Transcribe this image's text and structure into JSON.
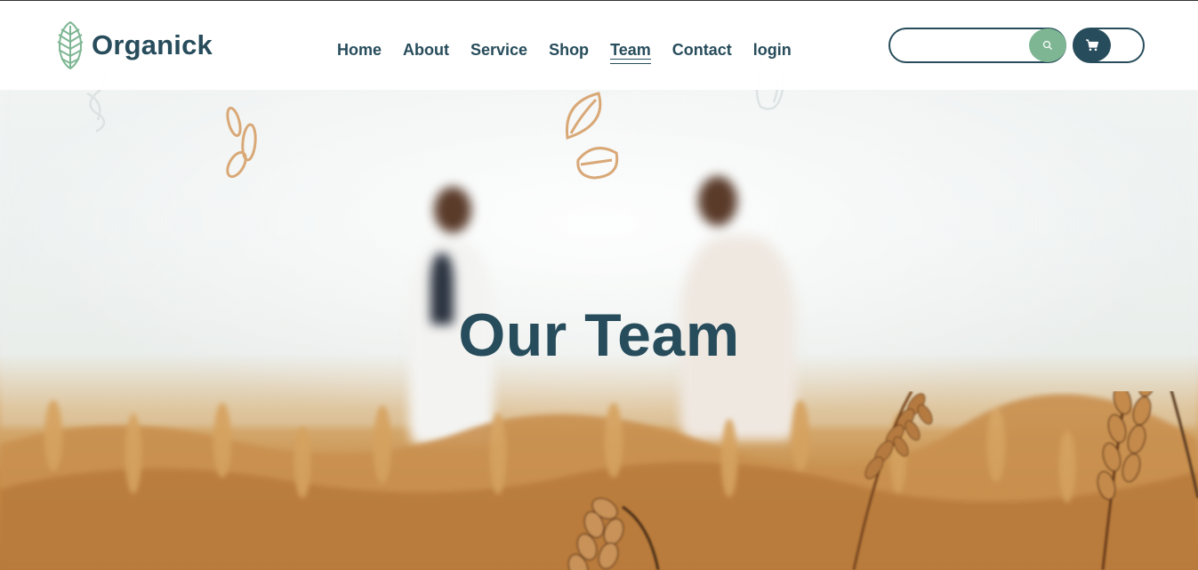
{
  "brand": {
    "name": "Organick",
    "logo_icon": "leaf-logo-icon",
    "color": "#274c5b",
    "accent": "#7eb693"
  },
  "nav": {
    "items": [
      {
        "label": "Home",
        "active": false
      },
      {
        "label": "About",
        "active": false
      },
      {
        "label": "Service",
        "active": false
      },
      {
        "label": "Shop",
        "active": false
      },
      {
        "label": "Team",
        "active": true
      },
      {
        "label": "Contact",
        "active": false
      },
      {
        "label": "login",
        "active": false
      }
    ]
  },
  "search": {
    "value": "",
    "placeholder": "",
    "button_icon": "search-icon"
  },
  "cart": {
    "icon": "cart-icon"
  },
  "hero": {
    "title": "Our Team"
  }
}
